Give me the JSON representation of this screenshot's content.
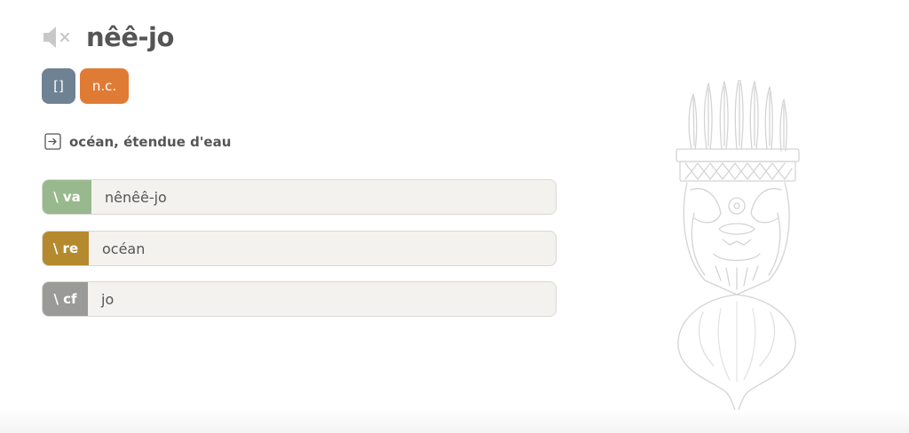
{
  "entry": {
    "headword": "nêê-jo",
    "audio_icon": "speaker-muted-icon"
  },
  "badges": {
    "pronunciation": "[]",
    "part_of_speech": "n.c."
  },
  "definition": {
    "icon": "arrow-right-box-icon",
    "text": "océan, étendue d'eau"
  },
  "relations": [
    {
      "tag": "\\ va",
      "value": "nênêê-jo",
      "color": "#98b98d"
    },
    {
      "tag": "\\ re",
      "value": "océan",
      "color": "#b58a2e"
    },
    {
      "tag": "\\ cf",
      "value": "jo",
      "color": "#9a9a99"
    }
  ],
  "illustration": {
    "icon": "carved-totem-figure-icon"
  },
  "colors": {
    "badge_pronunciation": "#6e8294",
    "badge_pos": "#e07b35",
    "text": "#555555"
  }
}
